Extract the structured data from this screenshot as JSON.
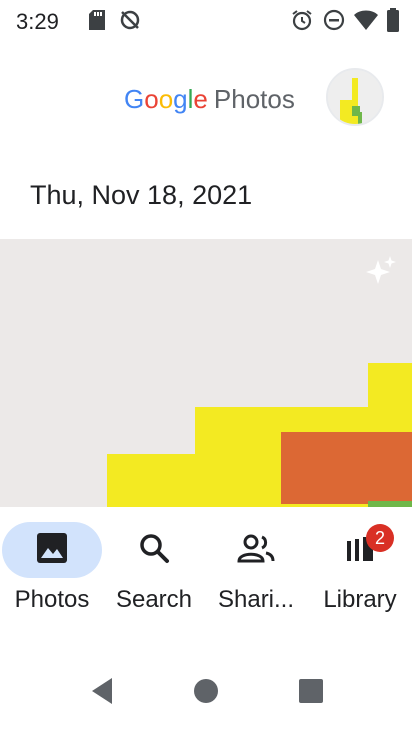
{
  "status_bar": {
    "time": "3:29",
    "left_icons": [
      "sd-card-icon",
      "sync-disabled-icon"
    ],
    "right_icons": [
      "alarm-icon",
      "do-not-disturb-icon",
      "wifi-icon",
      "battery-icon"
    ]
  },
  "app": {
    "logo_google": "Google",
    "logo_product": "Photos",
    "avatar": "account-avatar"
  },
  "timeline": {
    "date_label": "Thu, Nov 18, 2021",
    "photo_colors": {
      "background": "#ece9e8",
      "yellow": "#f3ea22",
      "orange": "#dc6834",
      "green": "#6fb74a"
    },
    "sparkle_icon": "auto-enhance-icon"
  },
  "bottom_nav": {
    "items": [
      {
        "label": "Photos",
        "icon": "photo-icon",
        "active": true
      },
      {
        "label": "Search",
        "icon": "search-icon",
        "active": false
      },
      {
        "label": "Shari...",
        "icon": "sharing-icon",
        "active": false
      },
      {
        "label": "Library",
        "icon": "library-icon",
        "active": false,
        "badge": "2"
      }
    ],
    "active_color": "#d2e3fc",
    "badge_color": "#d93025"
  },
  "system_nav": {
    "buttons": [
      "back-icon",
      "home-icon",
      "recents-icon"
    ]
  }
}
